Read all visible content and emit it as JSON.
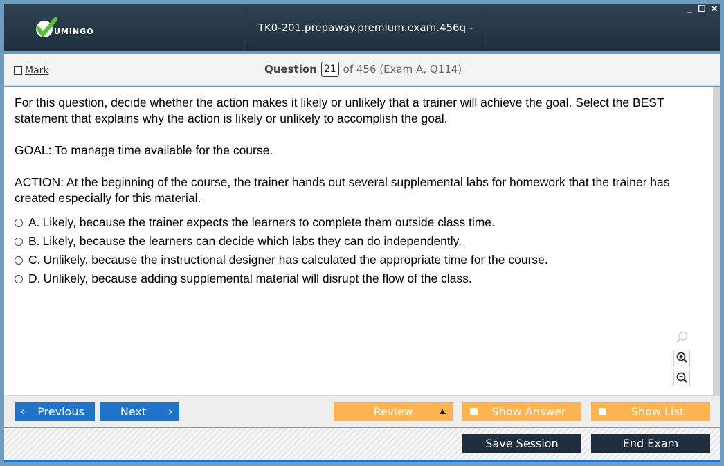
{
  "window": {
    "title": "TK0-201.prepaway.premium.exam.456q - Exam A - ETE Player",
    "controls": [
      "_",
      "☐",
      "✕"
    ]
  },
  "logo": {
    "text": "UMINGO",
    "check_color": "#58c033"
  },
  "header": {
    "mark_label": "Mark",
    "question_word": "Question",
    "question_number": "21",
    "question_of": "of 456 (Exam A, Q114)"
  },
  "question": {
    "paragraphs": [
      "For this question, decide whether the action makes it likely or unlikely that a trainer will achieve the goal. Select the BEST statement that explains why the action is likely or unlikely to accomplish the goal.",
      "GOAL: To manage time available for the course.",
      "ACTION: At the beginning of the course, the trainer hands out several supplemental labs for homework that the trainer has created especially for this material."
    ],
    "options": [
      {
        "letter": "A.",
        "text": "Likely, because the trainer expects the learners to complete them outside class time."
      },
      {
        "letter": "B.",
        "text": "Likely, because the learners can decide which labs they can do independently."
      },
      {
        "letter": "C.",
        "text": "Unlikely, because the instructional designer has calculated the appropriate time for the course."
      },
      {
        "letter": "D.",
        "text": "Unlikely, because adding supplemental material will disrupt the flow of the class."
      }
    ]
  },
  "nav": {
    "previous_label": "Previous",
    "next_label": "Next",
    "review_label": "Review",
    "show_answer_label": "Show Answer",
    "show_list_label": "Show List"
  },
  "bottom": {
    "save_session_label": "Save Session",
    "end_exam_label": "End Exam"
  },
  "colors": {
    "titlebar": "#24374a",
    "blue_button": "#1f73c8",
    "orange_button": "#fdb34f",
    "dark_button": "#1e2e3e"
  }
}
